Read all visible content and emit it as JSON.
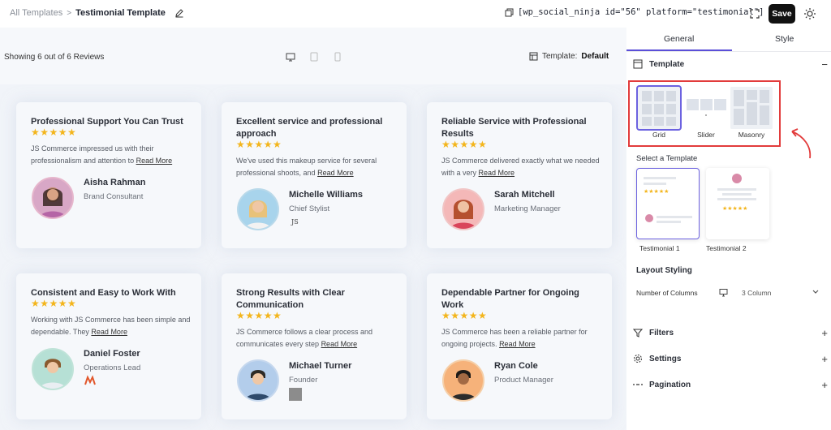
{
  "header": {
    "breadcrumb_root": "All Templates",
    "breadcrumb_sep": ">",
    "title": "Testimonial Template",
    "shortcode": "[wp_social_ninja id=\"56\" platform=\"testimonial\"]",
    "save_label": "Save"
  },
  "toolbar": {
    "showing": "Showing 6 out of 6 Reviews",
    "template_label": "Template:",
    "template_value": "Default"
  },
  "reviews": [
    {
      "title": "Professional Support You Can Trust",
      "stars": "★★★★★",
      "body": "JS Commerce impressed us with their professionalism and attention to",
      "more": "Read More",
      "name": "Aisha Rahman",
      "role": "Brand Consultant"
    },
    {
      "title": "Excellent service and professional approach",
      "stars": "★★★★★",
      "body": "We've used this makeup service for several professional shoots, and",
      "more": "Read More",
      "name": "Michelle Williams",
      "role": "Chief Stylist"
    },
    {
      "title": "Reliable Service with Professional Results",
      "stars": "★★★★★",
      "body": "JS Commerce delivered exactly what we needed with a very",
      "more": "Read More",
      "name": "Sarah Mitchell",
      "role": "Marketing Manager"
    },
    {
      "title": "Consistent and Easy to Work With",
      "stars": "★★★★★",
      "body": "Working with JS Commerce has been simple and dependable. They",
      "more": "Read More",
      "name": "Daniel Foster",
      "role": "Operations Lead"
    },
    {
      "title": "Strong Results with Clear Communication",
      "stars": "★★★★★",
      "body": "JS Commerce follows a clear process and communicates every step",
      "more": "Read More",
      "name": "Michael Turner",
      "role": "Founder"
    },
    {
      "title": "Dependable Partner for Ongoing Work",
      "stars": "★★★★★",
      "body": "JS Commerce has been a reliable partner for ongoing projects.",
      "more": "Read More",
      "name": "Ryan Cole",
      "role": "Product Manager"
    }
  ],
  "panel": {
    "tabs": [
      "General",
      "Style"
    ],
    "template_section": "Template",
    "layouts": [
      "Grid",
      "Slider",
      "Masonry"
    ],
    "select_template_label": "Select a Template",
    "templates": [
      "Testimonial 1",
      "Testimonial 2"
    ],
    "layout_styling": "Layout Styling",
    "columns_label": "Number of Columns",
    "columns_value": "3 Column",
    "sections": [
      "Filters",
      "Settings",
      "Pagination"
    ],
    "collapse_symbol": "−",
    "expand_symbol": "+"
  },
  "colors": {
    "accent": "#5b4fd8",
    "star": "#f3b51c",
    "highlight": "#e23b3b",
    "save_bg": "#111111"
  },
  "icons": [
    "edit-icon",
    "copy-icon",
    "expand-icon",
    "sun-icon",
    "desktop-icon",
    "tablet-icon",
    "mobile-icon",
    "template-icon",
    "filter-icon",
    "gear-icon",
    "pagination-icon",
    "monitor-icon",
    "chevron-down-icon"
  ]
}
